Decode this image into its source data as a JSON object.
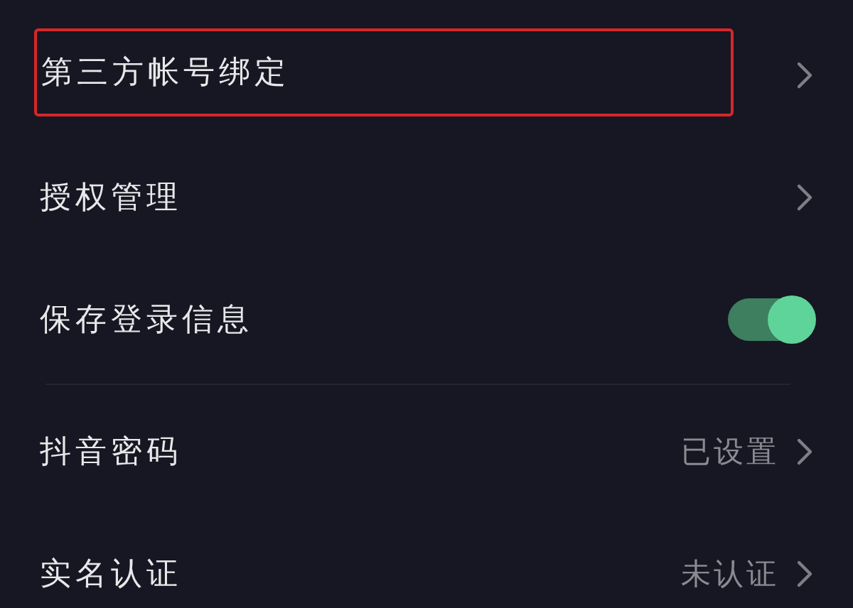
{
  "sections": [
    {
      "items": [
        {
          "kind": "link",
          "label": "第三方帐号绑定",
          "highlighted": true
        },
        {
          "kind": "link",
          "label": "授权管理",
          "highlighted": false
        },
        {
          "kind": "toggle",
          "label": "保存登录信息",
          "on": true
        }
      ]
    },
    {
      "items": [
        {
          "kind": "link",
          "label": "抖音密码",
          "value": "已设置"
        },
        {
          "kind": "link",
          "label": "实名认证",
          "value": "未认证"
        }
      ]
    }
  ]
}
